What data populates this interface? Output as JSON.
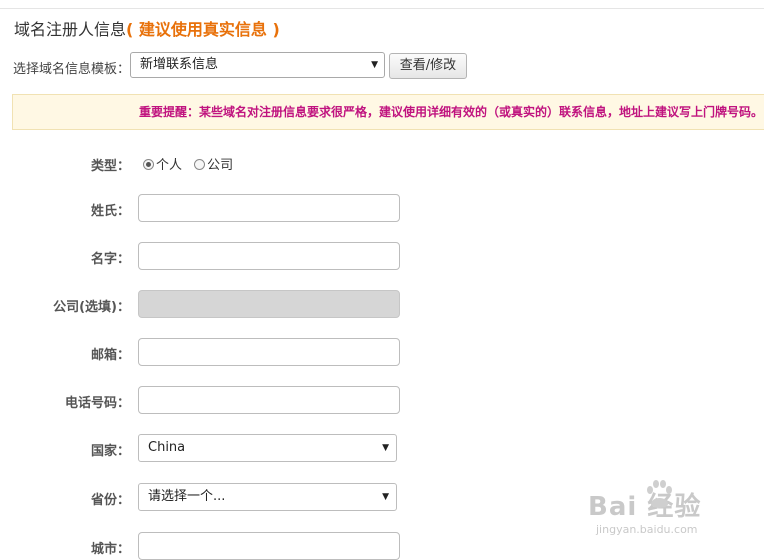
{
  "header": {
    "title": "域名注册人信息",
    "title_highlight": "( 建议使用真实信息 )"
  },
  "template": {
    "label": "选择域名信息模板：",
    "selected": "新增联系信息",
    "view_button": "查看/修改"
  },
  "notice": "重要提醒：某些域名对注册信息要求很严格，建议使用详细有效的（或真实的）联系信息，地址上建议写上门牌号码。",
  "form": {
    "type_label": "类型：",
    "type_options": [
      "个人",
      "公司"
    ],
    "type_selected": "个人",
    "surname_label": "姓氏：",
    "surname_value": "",
    "given_label": "名字：",
    "given_value": "",
    "company_label": "公司(选填)：",
    "company_value": "",
    "email_label": "邮箱：",
    "email_value": "",
    "phone_label": "电话号码：",
    "phone_value": "",
    "country_label": "国家：",
    "country_selected": "China",
    "province_label": "省份：",
    "province_selected": "请选择一个...",
    "city_label": "城市：",
    "city_value": ""
  },
  "watermark": {
    "text": "Bai 经验",
    "url": "jingyan.baidu.com"
  }
}
